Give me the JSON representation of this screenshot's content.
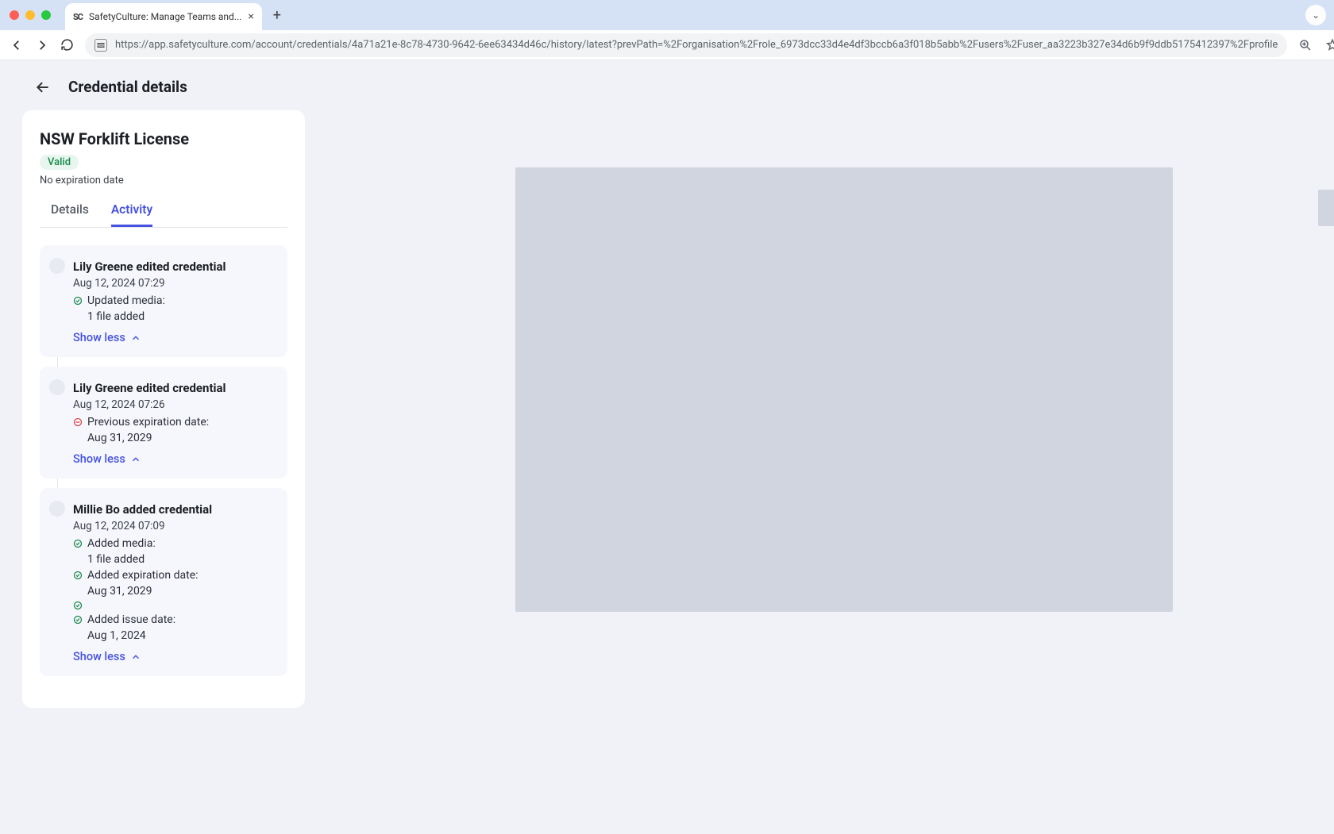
{
  "browser": {
    "tab_title": "SafetyCulture: Manage Teams and...",
    "url": "https://app.safetyculture.com/account/credentials/4a71a21e-8c78-4730-9642-6ee63434d46c/history/latest?prevPath=%2Forganisation%2Frole_6973dcc33d4e4df3bccb6a3f018b5abb%2Fusers%2Fuser_aa3223b327e34d6b9f9ddb5175412397%2Fprofile"
  },
  "page": {
    "title": "Credential details"
  },
  "credential": {
    "name": "NSW Forklift License",
    "status": "Valid",
    "expiration": "No expiration date"
  },
  "tabs": {
    "details": "Details",
    "activity": "Activity"
  },
  "activity": [
    {
      "title": "Lily Greene edited credential",
      "date": "Aug 12, 2024 07:29",
      "changes": [
        {
          "icon": "add",
          "label": "Updated media:",
          "value": "1 file added"
        }
      ],
      "toggle": "Show less"
    },
    {
      "title": "Lily Greene edited credential",
      "date": "Aug 12, 2024 07:26",
      "changes": [
        {
          "icon": "remove",
          "label": "Previous expiration date:",
          "value": "Aug 31, 2029"
        }
      ],
      "toggle": "Show less"
    },
    {
      "title": "Millie Bo added credential",
      "date": "Aug 12, 2024 07:09",
      "changes": [
        {
          "icon": "add",
          "label": "Added media:",
          "value": "1 file added"
        },
        {
          "icon": "add",
          "label": "Added expiration date:",
          "value": "Aug 31, 2029"
        },
        {
          "icon": "add",
          "label": "",
          "value": ""
        },
        {
          "icon": "add",
          "label": "Added issue date:",
          "value": "Aug 1, 2024"
        }
      ],
      "toggle": "Show less"
    }
  ]
}
